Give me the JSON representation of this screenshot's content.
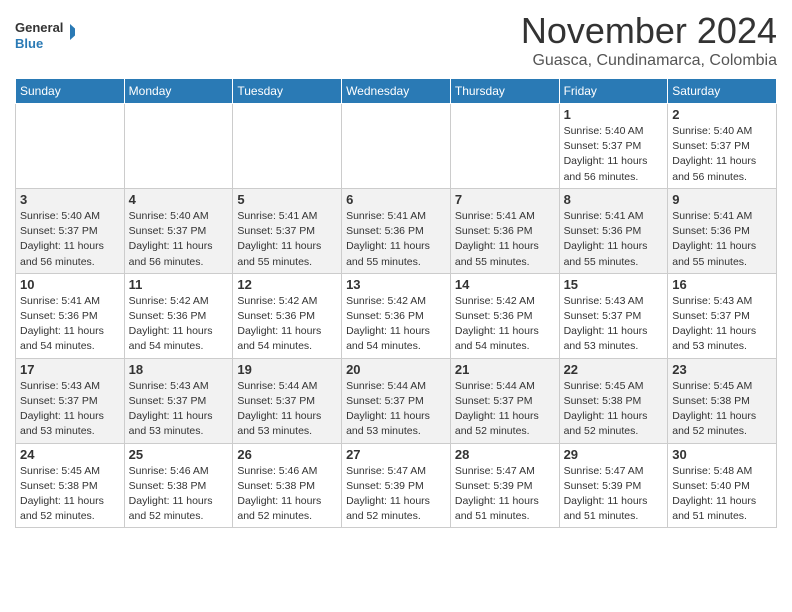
{
  "header": {
    "logo_text_general": "General",
    "logo_text_blue": "Blue",
    "month": "November 2024",
    "location": "Guasca, Cundinamarca, Colombia"
  },
  "days_of_week": [
    "Sunday",
    "Monday",
    "Tuesday",
    "Wednesday",
    "Thursday",
    "Friday",
    "Saturday"
  ],
  "weeks": [
    [
      {
        "day": "",
        "info": ""
      },
      {
        "day": "",
        "info": ""
      },
      {
        "day": "",
        "info": ""
      },
      {
        "day": "",
        "info": ""
      },
      {
        "day": "",
        "info": ""
      },
      {
        "day": "1",
        "info": "Sunrise: 5:40 AM\nSunset: 5:37 PM\nDaylight: 11 hours and 56 minutes."
      },
      {
        "day": "2",
        "info": "Sunrise: 5:40 AM\nSunset: 5:37 PM\nDaylight: 11 hours and 56 minutes."
      }
    ],
    [
      {
        "day": "3",
        "info": "Sunrise: 5:40 AM\nSunset: 5:37 PM\nDaylight: 11 hours and 56 minutes."
      },
      {
        "day": "4",
        "info": "Sunrise: 5:40 AM\nSunset: 5:37 PM\nDaylight: 11 hours and 56 minutes."
      },
      {
        "day": "5",
        "info": "Sunrise: 5:41 AM\nSunset: 5:37 PM\nDaylight: 11 hours and 55 minutes."
      },
      {
        "day": "6",
        "info": "Sunrise: 5:41 AM\nSunset: 5:36 PM\nDaylight: 11 hours and 55 minutes."
      },
      {
        "day": "7",
        "info": "Sunrise: 5:41 AM\nSunset: 5:36 PM\nDaylight: 11 hours and 55 minutes."
      },
      {
        "day": "8",
        "info": "Sunrise: 5:41 AM\nSunset: 5:36 PM\nDaylight: 11 hours and 55 minutes."
      },
      {
        "day": "9",
        "info": "Sunrise: 5:41 AM\nSunset: 5:36 PM\nDaylight: 11 hours and 55 minutes."
      }
    ],
    [
      {
        "day": "10",
        "info": "Sunrise: 5:41 AM\nSunset: 5:36 PM\nDaylight: 11 hours and 54 minutes."
      },
      {
        "day": "11",
        "info": "Sunrise: 5:42 AM\nSunset: 5:36 PM\nDaylight: 11 hours and 54 minutes."
      },
      {
        "day": "12",
        "info": "Sunrise: 5:42 AM\nSunset: 5:36 PM\nDaylight: 11 hours and 54 minutes."
      },
      {
        "day": "13",
        "info": "Sunrise: 5:42 AM\nSunset: 5:36 PM\nDaylight: 11 hours and 54 minutes."
      },
      {
        "day": "14",
        "info": "Sunrise: 5:42 AM\nSunset: 5:36 PM\nDaylight: 11 hours and 54 minutes."
      },
      {
        "day": "15",
        "info": "Sunrise: 5:43 AM\nSunset: 5:37 PM\nDaylight: 11 hours and 53 minutes."
      },
      {
        "day": "16",
        "info": "Sunrise: 5:43 AM\nSunset: 5:37 PM\nDaylight: 11 hours and 53 minutes."
      }
    ],
    [
      {
        "day": "17",
        "info": "Sunrise: 5:43 AM\nSunset: 5:37 PM\nDaylight: 11 hours and 53 minutes."
      },
      {
        "day": "18",
        "info": "Sunrise: 5:43 AM\nSunset: 5:37 PM\nDaylight: 11 hours and 53 minutes."
      },
      {
        "day": "19",
        "info": "Sunrise: 5:44 AM\nSunset: 5:37 PM\nDaylight: 11 hours and 53 minutes."
      },
      {
        "day": "20",
        "info": "Sunrise: 5:44 AM\nSunset: 5:37 PM\nDaylight: 11 hours and 53 minutes."
      },
      {
        "day": "21",
        "info": "Sunrise: 5:44 AM\nSunset: 5:37 PM\nDaylight: 11 hours and 52 minutes."
      },
      {
        "day": "22",
        "info": "Sunrise: 5:45 AM\nSunset: 5:38 PM\nDaylight: 11 hours and 52 minutes."
      },
      {
        "day": "23",
        "info": "Sunrise: 5:45 AM\nSunset: 5:38 PM\nDaylight: 11 hours and 52 minutes."
      }
    ],
    [
      {
        "day": "24",
        "info": "Sunrise: 5:45 AM\nSunset: 5:38 PM\nDaylight: 11 hours and 52 minutes."
      },
      {
        "day": "25",
        "info": "Sunrise: 5:46 AM\nSunset: 5:38 PM\nDaylight: 11 hours and 52 minutes."
      },
      {
        "day": "26",
        "info": "Sunrise: 5:46 AM\nSunset: 5:38 PM\nDaylight: 11 hours and 52 minutes."
      },
      {
        "day": "27",
        "info": "Sunrise: 5:47 AM\nSunset: 5:39 PM\nDaylight: 11 hours and 52 minutes."
      },
      {
        "day": "28",
        "info": "Sunrise: 5:47 AM\nSunset: 5:39 PM\nDaylight: 11 hours and 51 minutes."
      },
      {
        "day": "29",
        "info": "Sunrise: 5:47 AM\nSunset: 5:39 PM\nDaylight: 11 hours and 51 minutes."
      },
      {
        "day": "30",
        "info": "Sunrise: 5:48 AM\nSunset: 5:40 PM\nDaylight: 11 hours and 51 minutes."
      }
    ]
  ]
}
